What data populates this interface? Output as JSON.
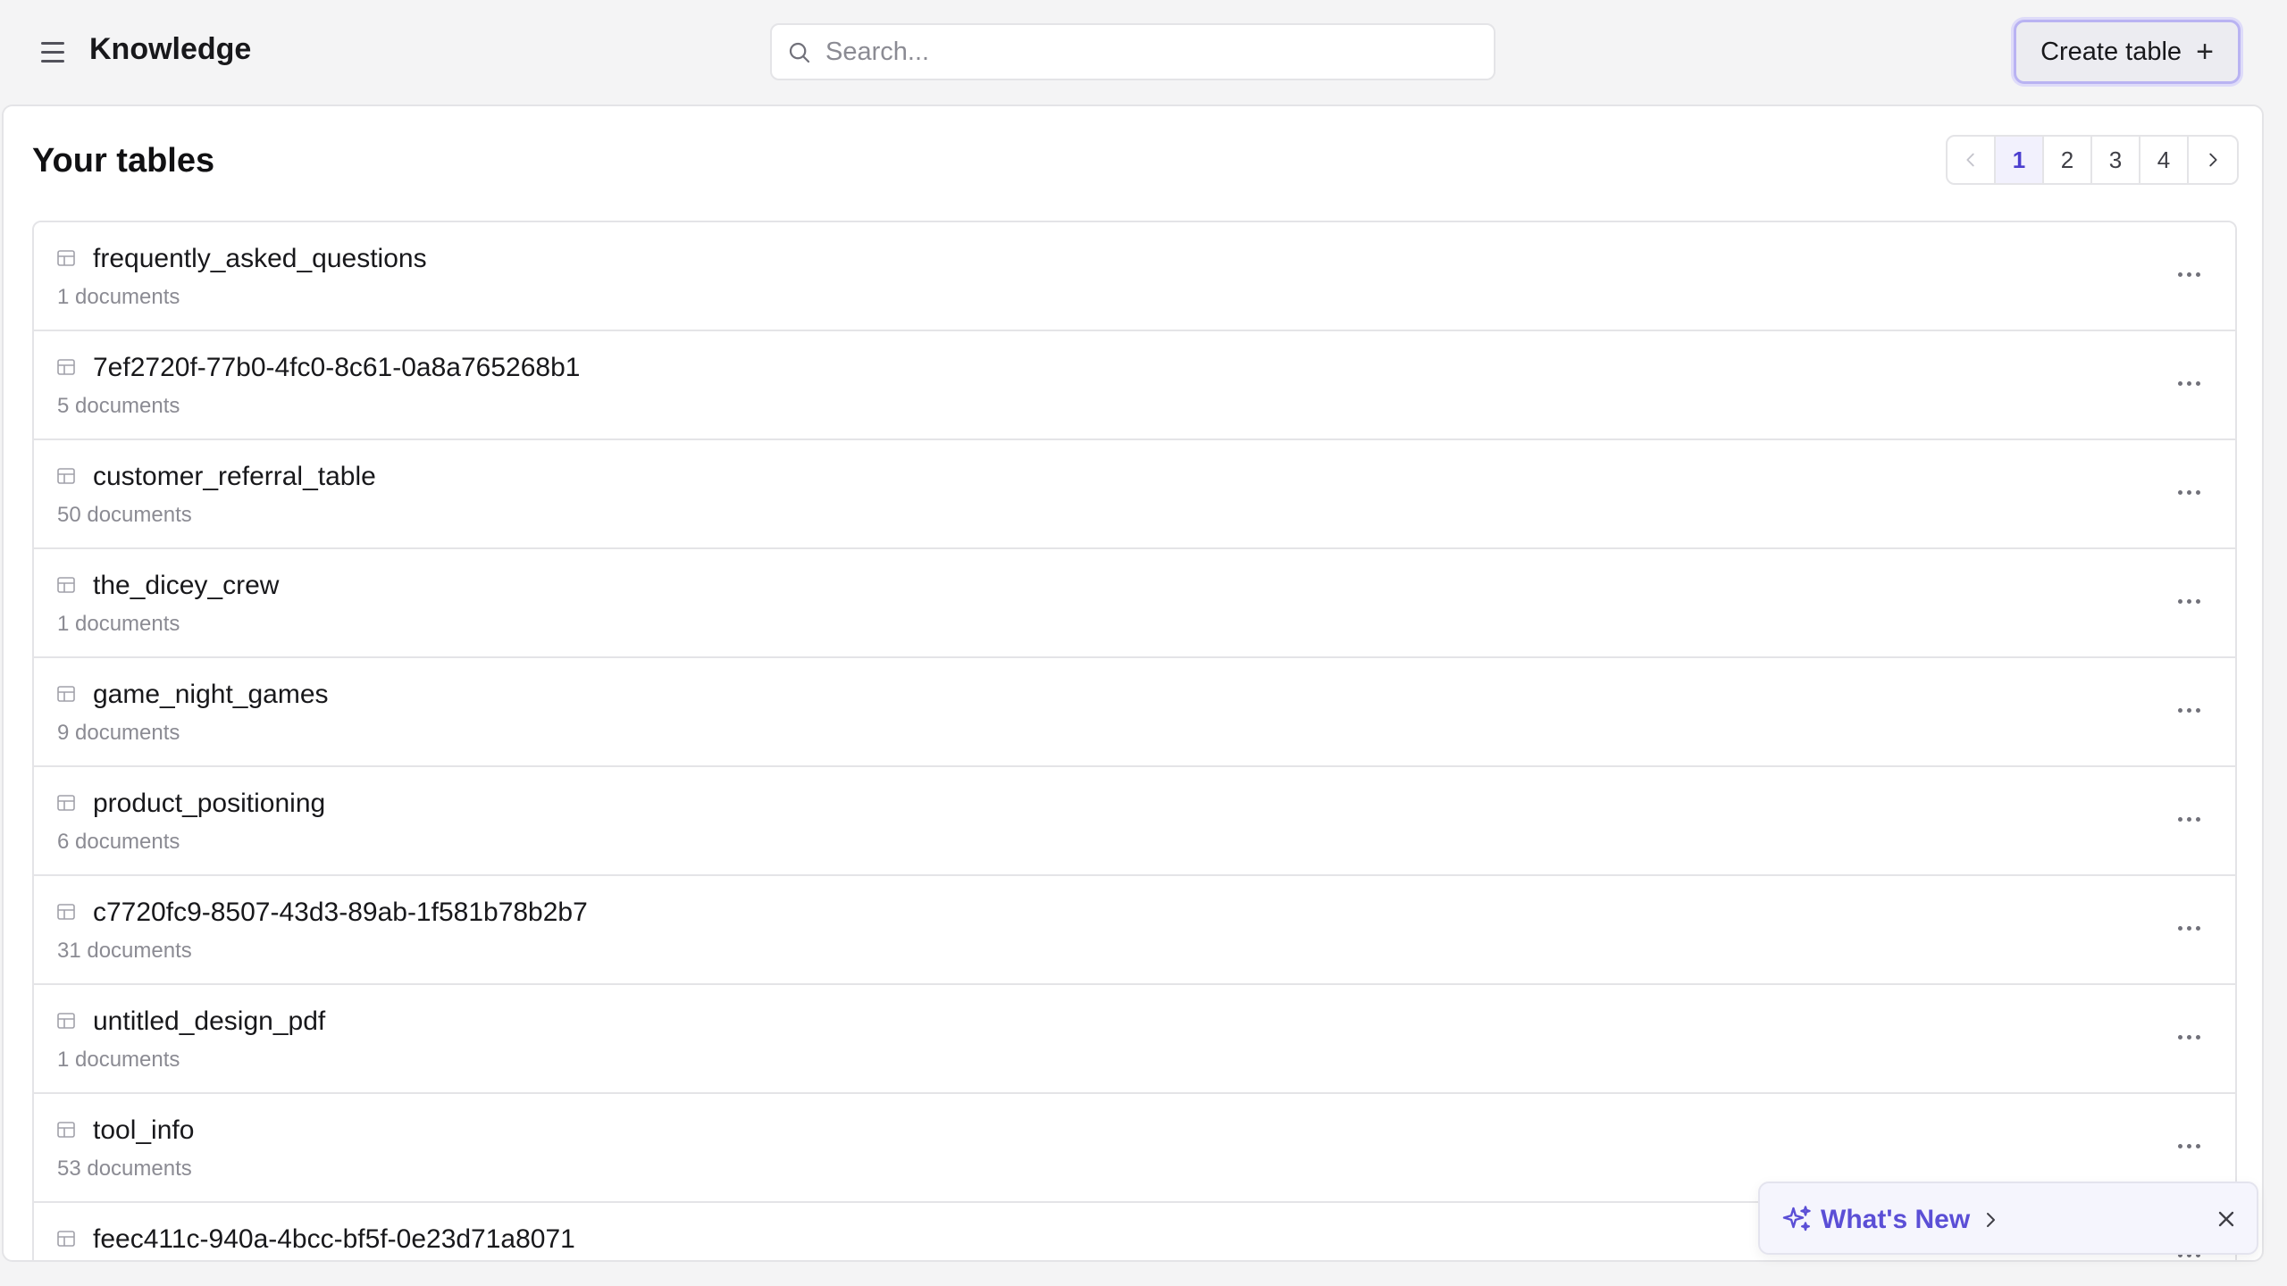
{
  "header": {
    "title": "Knowledge",
    "menu_icon": "hamburger-menu-icon",
    "search": {
      "placeholder": "Search...",
      "value": ""
    },
    "create_button": {
      "label": "Create table",
      "icon": "plus-icon"
    }
  },
  "main": {
    "title": "Your tables",
    "pagination": {
      "pages": [
        "1",
        "2",
        "3",
        "4"
      ],
      "current": "1",
      "prev_disabled": true
    },
    "tables": [
      {
        "name": "frequently_asked_questions",
        "count": "1 documents"
      },
      {
        "name": "7ef2720f-77b0-4fc0-8c61-0a8a765268b1",
        "count": "5 documents"
      },
      {
        "name": "customer_referral_table",
        "count": "50 documents"
      },
      {
        "name": "the_dicey_crew",
        "count": "1 documents"
      },
      {
        "name": "game_night_games",
        "count": "9 documents"
      },
      {
        "name": "product_positioning",
        "count": "6 documents"
      },
      {
        "name": "c7720fc9-8507-43d3-89ab-1f581b78b2b7",
        "count": "31 documents"
      },
      {
        "name": "untitled_design_pdf",
        "count": "1 documents"
      },
      {
        "name": "tool_info",
        "count": "53 documents"
      },
      {
        "name": "feec411c-940a-4bcc-bf5f-0e23d71a8071",
        "count": ""
      }
    ]
  },
  "toast": {
    "label": "What's New",
    "icon": "sparkle-icon"
  },
  "colors": {
    "accent": "#5b4fd6",
    "background": "#f4f4f5",
    "border": "#e4e4e7"
  }
}
